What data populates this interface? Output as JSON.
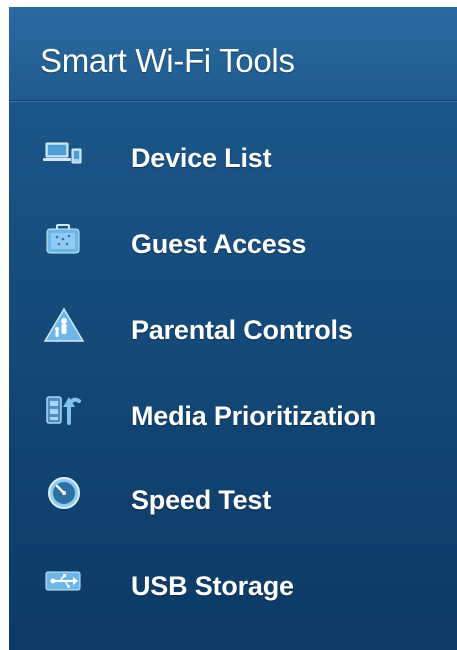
{
  "panel": {
    "title": "Smart Wi-Fi Tools",
    "items": [
      {
        "label": "Device List",
        "icon": "device-list-icon"
      },
      {
        "label": "Guest Access",
        "icon": "guest-access-icon"
      },
      {
        "label": "Parental Controls",
        "icon": "parental-controls-icon"
      },
      {
        "label": "Media Prioritization",
        "icon": "media-prioritization-icon"
      },
      {
        "label": "Speed Test",
        "icon": "speed-test-icon"
      },
      {
        "label": "USB Storage",
        "icon": "usb-storage-icon"
      }
    ]
  },
  "colors": {
    "panel_background": "#174f80",
    "text": "#ffffff",
    "icon_accent": "#7fc3ef"
  }
}
